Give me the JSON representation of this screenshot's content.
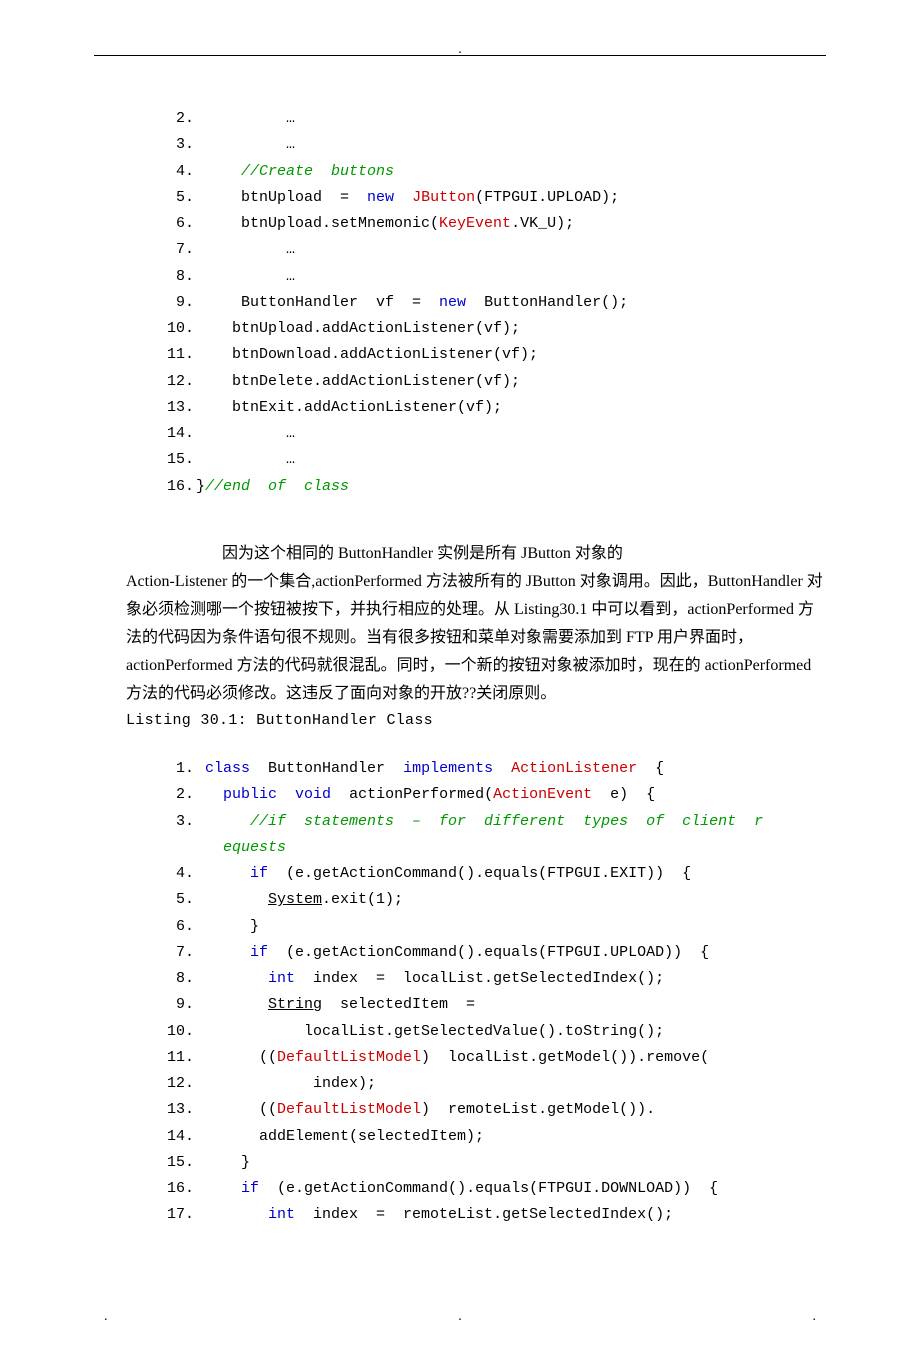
{
  "code1": {
    "lines": [
      {
        "num": "2.",
        "segments": [
          {
            "t": "          …"
          }
        ]
      },
      {
        "num": "3.",
        "segments": [
          {
            "t": "          …"
          }
        ]
      },
      {
        "num": "4.",
        "segments": [
          {
            "t": "     "
          },
          {
            "t": "//Create  buttons",
            "cls": "cm"
          }
        ]
      },
      {
        "num": "5.",
        "segments": [
          {
            "t": "     btnUpload  =  "
          },
          {
            "t": "new",
            "cls": "kw"
          },
          {
            "t": "  "
          },
          {
            "t": "JButton",
            "cls": "cls"
          },
          {
            "t": "(FTPGUI.UPLOAD);"
          }
        ]
      },
      {
        "num": "6.",
        "segments": [
          {
            "t": "     btnUpload.setMnemonic("
          },
          {
            "t": "KeyEvent",
            "cls": "cls"
          },
          {
            "t": ".VK_U);"
          }
        ]
      },
      {
        "num": "7.",
        "segments": [
          {
            "t": "          …"
          }
        ]
      },
      {
        "num": "8.",
        "segments": [
          {
            "t": "          …"
          }
        ]
      },
      {
        "num": "9.",
        "segments": [
          {
            "t": "     ButtonHandler  vf  =  "
          },
          {
            "t": "new",
            "cls": "kw"
          },
          {
            "t": "  ButtonHandler();"
          }
        ]
      },
      {
        "num": "10.",
        "segments": [
          {
            "t": "    btnUpload.addActionListener(vf);"
          }
        ]
      },
      {
        "num": "11.",
        "segments": [
          {
            "t": "    btnDownload.addActionListener(vf);"
          }
        ]
      },
      {
        "num": "12.",
        "segments": [
          {
            "t": "    btnDelete.addActionListener(vf);"
          }
        ]
      },
      {
        "num": "13.",
        "segments": [
          {
            "t": "    btnExit.addActionListener(vf);"
          }
        ]
      },
      {
        "num": "14.",
        "segments": [
          {
            "t": "          …"
          }
        ]
      },
      {
        "num": "15.",
        "segments": [
          {
            "t": "          …"
          }
        ]
      },
      {
        "num": "16.",
        "segments": [
          {
            "t": "}"
          },
          {
            "t": "//end  of  class",
            "cls": "cm"
          }
        ]
      }
    ]
  },
  "para": {
    "p1": "因为这个相同的 ButtonHandler 实例是所有 JButton 对象的",
    "p2": "Action-Listener 的一个集合,actionPerformed 方法被所有的 JButton 对象调用。因此，ButtonHandler 对象必须检测哪一个按钮被按下，并执行相应的处理。从 Listing30.1 中可以看到，actionPerformed 方法的代码因为条件语句很不规则。当有很多按钮和菜单对象需要添加到 FTP 用户界面时，actionPerformed 方法的代码就很混乱。同时，一个新的按钮对象被添加时，现在的 actionPerformed方法的代码必须修改。这违反了面向对象的开放??关闭原则。",
    "listing": "Listing  30.1:  ButtonHandler  Class"
  },
  "code2": {
    "lines": [
      {
        "num": "1.",
        "segments": [
          {
            "t": " "
          },
          {
            "t": "class",
            "cls": "kw"
          },
          {
            "t": "  ButtonHandler  "
          },
          {
            "t": "implements",
            "cls": "kw"
          },
          {
            "t": "  "
          },
          {
            "t": "ActionListener",
            "cls": "cls"
          },
          {
            "t": "  {"
          }
        ]
      },
      {
        "num": "2.",
        "segments": [
          {
            "t": "   "
          },
          {
            "t": "public",
            "cls": "kw"
          },
          {
            "t": "  "
          },
          {
            "t": "void",
            "cls": "kw"
          },
          {
            "t": "  actionPerformed("
          },
          {
            "t": "ActionEvent",
            "cls": "cls"
          },
          {
            "t": "  e)  {"
          }
        ]
      },
      {
        "num": "3.",
        "segments": [
          {
            "t": "      "
          },
          {
            "t": "//if  statements  –  for  different  types  of  client  r",
            "cls": "cm"
          }
        ]
      },
      {
        "num": "",
        "segments": [
          {
            "t": "   "
          },
          {
            "t": "equests",
            "cls": "cm"
          }
        ]
      },
      {
        "num": "4.",
        "segments": [
          {
            "t": "      "
          },
          {
            "t": "if",
            "cls": "kw"
          },
          {
            "t": "  (e.getActionCommand().equals(FTPGUI.EXIT))  {"
          }
        ]
      },
      {
        "num": "5.",
        "segments": [
          {
            "t": "        "
          },
          {
            "t": "System",
            "cls": "underline"
          },
          {
            "t": ".exit(1);"
          }
        ]
      },
      {
        "num": "6.",
        "segments": [
          {
            "t": "      }"
          }
        ]
      },
      {
        "num": "7.",
        "segments": [
          {
            "t": "      "
          },
          {
            "t": "if",
            "cls": "kw"
          },
          {
            "t": "  (e.getActionCommand().equals(FTPGUI.UPLOAD))  {"
          }
        ]
      },
      {
        "num": "8.",
        "segments": [
          {
            "t": "        "
          },
          {
            "t": "int",
            "cls": "kw"
          },
          {
            "t": "  index  =  localList.getSelectedIndex();"
          }
        ]
      },
      {
        "num": "9.",
        "segments": [
          {
            "t": "        "
          },
          {
            "t": "String",
            "cls": "underline"
          },
          {
            "t": "  selectedItem  ="
          }
        ]
      },
      {
        "num": "10.",
        "segments": [
          {
            "t": "            localList.getSelectedValue().toString();"
          }
        ]
      },
      {
        "num": "11.",
        "segments": [
          {
            "t": "       (("
          },
          {
            "t": "DefaultListModel",
            "cls": "cls"
          },
          {
            "t": ")  localList.getModel()).remove("
          }
        ]
      },
      {
        "num": "12.",
        "segments": [
          {
            "t": "             index);"
          }
        ]
      },
      {
        "num": "13.",
        "segments": [
          {
            "t": "       (("
          },
          {
            "t": "DefaultListModel",
            "cls": "cls"
          },
          {
            "t": ")  remoteList.getModel())."
          }
        ]
      },
      {
        "num": "14.",
        "segments": [
          {
            "t": "       addElement(selectedItem);"
          }
        ]
      },
      {
        "num": "15.",
        "segments": [
          {
            "t": "     }"
          }
        ]
      },
      {
        "num": "16.",
        "segments": [
          {
            "t": "     "
          },
          {
            "t": "if",
            "cls": "kw"
          },
          {
            "t": "  (e.getActionCommand().equals(FTPGUI.DOWNLOAD))  {"
          }
        ]
      },
      {
        "num": "17.",
        "segments": [
          {
            "t": "        "
          },
          {
            "t": "int",
            "cls": "kw"
          },
          {
            "t": "  index  =  remoteList.getSelectedIndex();"
          }
        ]
      }
    ]
  },
  "footer": {
    "d1": ".",
    "d2": ".",
    "d3": "."
  }
}
